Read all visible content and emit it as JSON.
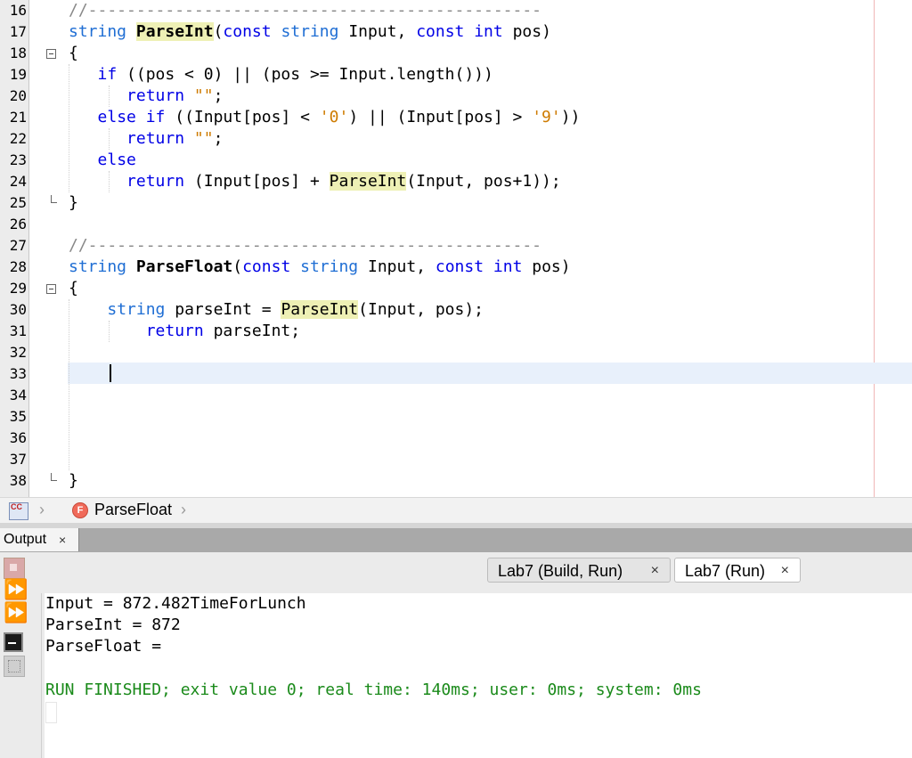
{
  "editor": {
    "line_numbers": [
      "16",
      "17",
      "18",
      "19",
      "20",
      "21",
      "22",
      "23",
      "24",
      "25",
      "26",
      "27",
      "28",
      "29",
      "30",
      "31",
      "32",
      "33",
      "34",
      "35",
      "36",
      "37",
      "38"
    ],
    "comment_rule_1": "//-----------------------------------------------",
    "fn1_ret_type": "string",
    "fn1_name": "ParseInt",
    "fn1_params_1": "(",
    "fn1_params_kw1": "const",
    "fn1_params_ty1": "string",
    "fn1_params_2": " Input, ",
    "fn1_params_kw2": "const",
    "fn1_params_ty2": "int",
    "fn1_params_3": " pos)",
    "brace_open": "{",
    "brace_close": "}",
    "l19_kw": "if",
    "l19_rest": " ((pos < 0) || (pos >= Input.length()))",
    "return_kw": "return",
    "empty_str": "\"\"",
    "semi": ";",
    "l21_kw1": "else",
    "l21_kw2": "if",
    "l21_a": " ((Input[pos] < ",
    "l21_str1": "'0'",
    "l21_b": ") || (Input[pos] > ",
    "l21_str2": "'9'",
    "l21_c": "))",
    "l23_kw": "else",
    "l24_a": " (Input[pos] + ",
    "l24_call": "ParseInt",
    "l24_b": "(Input, pos+1));",
    "comment_rule_2": "//-----------------------------------------------",
    "fn2_ret_type": "string",
    "fn2_name": "ParseFloat",
    "l30_ty": "string",
    "l30_a": " parseInt = ",
    "l30_call": "ParseInt",
    "l30_b": "(Input, pos);",
    "l31_rest": " parseInt;"
  },
  "breadcrumb": {
    "file_icon_text": "CC",
    "function_icon": "F",
    "function_label": "ParseFloat"
  },
  "output": {
    "tab_label": "Output",
    "tab_close": "×",
    "subtabs": [
      {
        "label": "Lab7 (Build, Run)",
        "close": "×"
      },
      {
        "label": "Lab7 (Run)",
        "close": "×"
      }
    ],
    "lines": [
      "Input = 872.482TimeForLunch",
      "ParseInt = 872",
      "ParseFloat ="
    ],
    "status_line": "RUN FINISHED; exit value 0; real time: 140ms; user: 0ms; system: 0ms",
    "icons": [
      "stop-icon",
      "rerun-icon",
      "rerun-icon",
      "terminal-icon",
      "settings-icon"
    ],
    "colors": {
      "status": "#1a8a1a",
      "keyword": "#0000e6",
      "type": "#1f6ed4",
      "string": "#ce7b00",
      "highlight": "#eef0b5"
    }
  }
}
